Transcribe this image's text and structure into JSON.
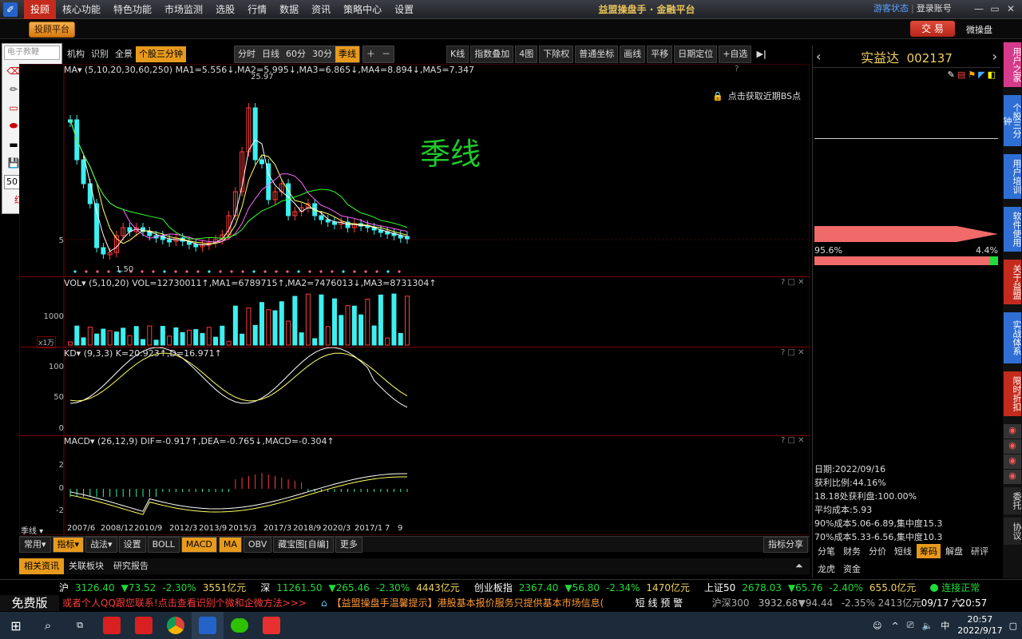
{
  "topbar": {
    "menu": [
      "投顾",
      "核心功能",
      "特色功能",
      "市场监测",
      "选股",
      "行情",
      "数据",
      "资讯",
      "策略中心",
      "设置"
    ],
    "title": "益盟操盘手 · 金融平台",
    "guest": "游客状态",
    "sep": "|",
    "login": "登录账号",
    "minimize": "▭",
    "restore": "▭",
    "close": "✕"
  },
  "bar2": {
    "advisor": "投顾平台",
    "trade": "交 易",
    "wechat": "微操盘"
  },
  "tools": {
    "search_placeholder": "电子教鞭",
    "size": "50",
    "brand": "红烛软件"
  },
  "toolbar": {
    "left": [
      "机构",
      "识别",
      "全景",
      "个股三分钟"
    ],
    "periods": [
      "分时",
      "日线",
      "60分",
      "30分",
      "季线"
    ],
    "right": [
      "K线",
      "指数叠加",
      "4图",
      "下除权",
      "普通坐标",
      "画线",
      "平移",
      "日期定位",
      "+自选"
    ]
  },
  "main": {
    "ma_head": "MA▾ (5,10,20,30,60,250)  MA1=5.556↓,MA2=5.995↓,MA3=6.865↓,MA4=8.894↓,MA5=7.347",
    "peak": "25.97",
    "low": "1.50",
    "period_watermark": "季线",
    "bs_hint": "点击获取近期BS点",
    "ytick": "5",
    "vol_head": "VOL▾ (5,10,20)  VOL=12730011↑,MA1=6789715↑,MA2=7476013↓,MA3=8731304↑",
    "vol_tick": "1000",
    "vol_unit": "x1万",
    "kd_head": "KD▾ (9,3,3)  K=20.923↑,D=16.971↑",
    "kd_ticks": [
      "100",
      "50",
      "0"
    ],
    "macd_head": "MACD▾ (26,12,9)  DIF=-0.917↑,DEA=-0.765↓,MACD=-0.304↑",
    "macd_ticks": [
      "2",
      "0",
      "-2"
    ],
    "period_label": "季线 ▾",
    "dates": [
      "2007/6",
      "2008/12",
      "2010/9",
      "2012/3",
      "2013/9",
      "2015/3",
      "2017/3",
      "2018/9",
      "2020/3",
      "2017/1",
      "7",
      "9"
    ],
    "panel_ctrls": "? □ ✕"
  },
  "bottombar": {
    "groups": [
      "常用▾",
      "指标▾",
      "战法▾"
    ],
    "tabs": [
      "设置",
      "BOLL",
      "MACD",
      "MA",
      "OBV",
      "藏宝图[自编]",
      "更多"
    ],
    "share": "指标分享"
  },
  "infotabs": {
    "items": [
      "相关资讯",
      "关联板块",
      "研究报告"
    ],
    "collapse": "⏶"
  },
  "right": {
    "name": "实益达",
    "code": "002137",
    "buy_pct": "95.6%",
    "sell_pct": "4.4%",
    "stats": [
      "日期:2022/09/16",
      "获利比例:44.16%",
      "18.18处获利盘:100.00%",
      "平均成本:5.93",
      "90%成本5.06-6.89,集中度15.3",
      "70%成本5.33-6.56,集中度10.3"
    ],
    "tabs1": [
      "分笔",
      "财务",
      "分价",
      "短线",
      "筹码",
      "解盘",
      "研评"
    ],
    "tabs2": [
      "龙虎",
      "资金"
    ]
  },
  "side": [
    {
      "t": "用户之家",
      "c": "#d63a8a"
    },
    {
      "t": "个股三分钟",
      "c": "#2f6fd3"
    },
    {
      "t": "用户培训",
      "c": "#2f6fd3"
    },
    {
      "t": "软件使用",
      "c": "#2f6fd3"
    },
    {
      "t": "关于益盟",
      "c": "#c42b1c"
    },
    {
      "t": "实战体系",
      "c": "#2f6fd3"
    },
    {
      "t": "限时折扣",
      "c": "#c42b1c"
    }
  ],
  "side_bottom": [
    "委托",
    "协议"
  ],
  "ticker": {
    "free": "免费版",
    "items": [
      {
        "n": "沪",
        "v": "3126.40",
        "c": "▼73.52",
        "p": "-2.30%",
        "a": "3551亿元"
      },
      {
        "n": "深",
        "v": "11261.50",
        "c": "▼265.46",
        "p": "-2.30%",
        "a": "4443亿元"
      },
      {
        "n": "创业板指",
        "v": "2367.40",
        "c": "▼56.80",
        "p": "-2.34%",
        "a": "1470亿元"
      },
      {
        "n": "上证50",
        "v": "2678.03",
        "c": "▼65.76",
        "p": "-2.40%",
        "a": "655.0亿元"
      }
    ],
    "status": "连接正常"
  },
  "scroll": {
    "text": "或者个人QQ跟您联系!点击查看识别个微和企微方法>>>",
    "notice": "【益盟操盘手温馨提示】港股基本报价服务只提供基本市场信息(",
    "alert": "短 线 预 警",
    "hs300": "沪深300",
    "hs_v": "3932.68",
    "hs_c": "▼94.44",
    "hs_p": "-2.35%",
    "hs_a": "2413亿元",
    "date": "09/17 六",
    "time": "20:57"
  },
  "taskbar": {
    "time": "20:57",
    "date": "2022/9/17",
    "ime": "中"
  }
}
